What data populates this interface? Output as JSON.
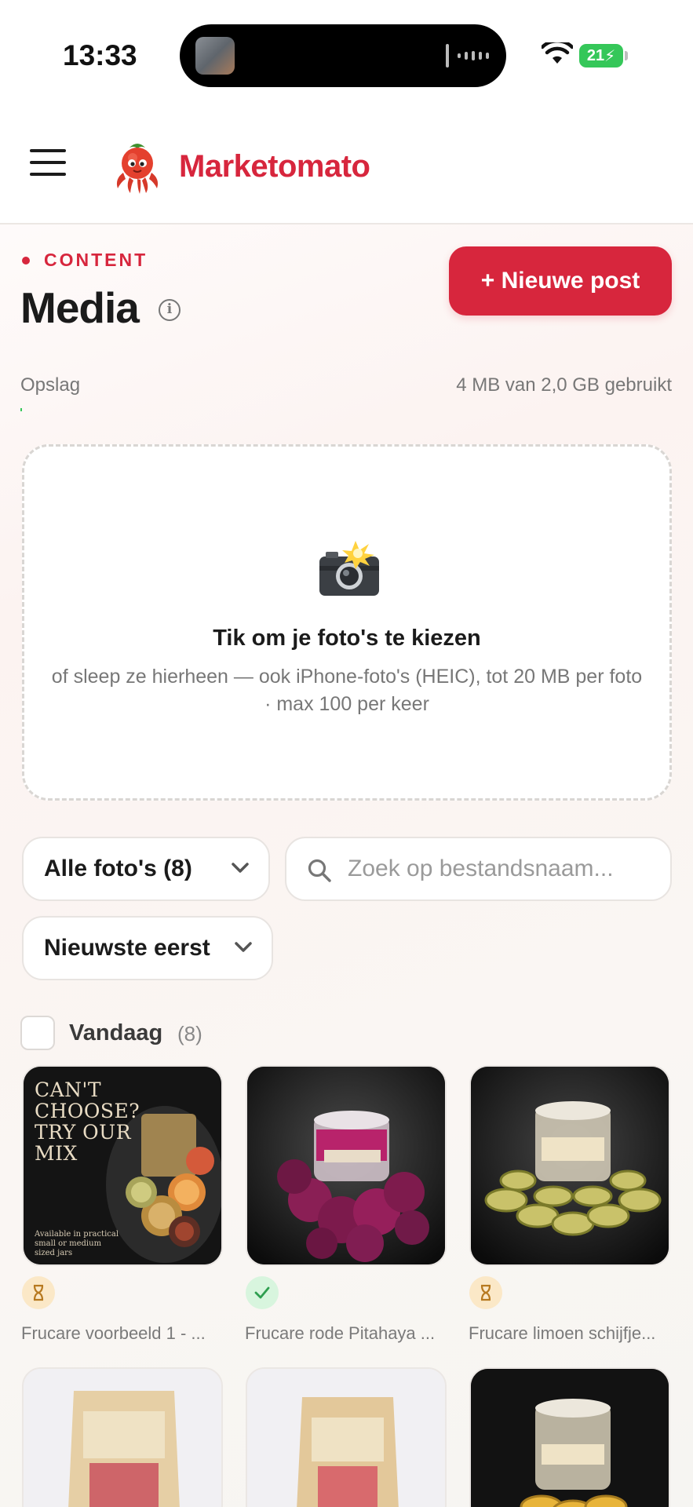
{
  "status_bar": {
    "time": "13:33",
    "battery": "21",
    "icons": [
      "wifi-icon",
      "battery-charging-icon"
    ]
  },
  "header": {
    "brand": "Marketomato",
    "logo_icon": "tomato-octopus-logo",
    "menu_icon": "hamburger-menu-icon"
  },
  "content": {
    "eyebrow": "CONTENT",
    "title": "Media",
    "new_post_label": "+ Nieuwe post",
    "accent_color": "#d7263d"
  },
  "storage": {
    "label": "Opslag",
    "usage": "4 MB van 2,0 GB gebruikt",
    "fill_fraction": 0.002
  },
  "dropzone": {
    "icon": "camera-flash-icon",
    "title": "Tik om je foto's te kiezen",
    "subtitle": "of sleep ze hierheen — ook iPhone-foto's (HEIC), tot 20 MB per foto · max 100 per keer"
  },
  "filters": {
    "album_select": "Alle foto's (8)",
    "sort_select": "Nieuwste eerst",
    "search_placeholder": "Zoek op bestandsnaam..."
  },
  "group": {
    "label": "Vandaag",
    "count": "(8)"
  },
  "media": [
    {
      "caption": "Frucare voorbeeld 1 - ...",
      "status": "pending",
      "image_text": "CAN'T CHOOSE? TRY OUR MIX",
      "image_note": "Available in practical small or medium sized jars"
    },
    {
      "caption": "Frucare rode Pitahaya ...",
      "status": "done"
    },
    {
      "caption": "Frucare limoen schijfje...",
      "status": "pending"
    },
    {
      "caption": "",
      "status": ""
    },
    {
      "caption": "",
      "status": ""
    },
    {
      "caption": "",
      "status": ""
    }
  ]
}
